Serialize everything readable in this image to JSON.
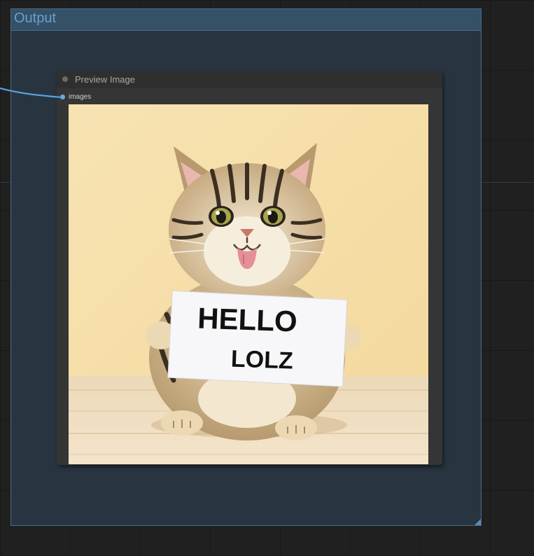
{
  "group": {
    "title": "Output"
  },
  "node": {
    "title": "Preview Image",
    "input_label": "images"
  },
  "preview": {
    "sign_line1": "HELLO",
    "sign_line2": "LOLZ"
  },
  "colors": {
    "link_wire": "#5aa0e0",
    "group_title": "#6a9fd0",
    "group_header": "#355168",
    "group_body": "#283541"
  }
}
